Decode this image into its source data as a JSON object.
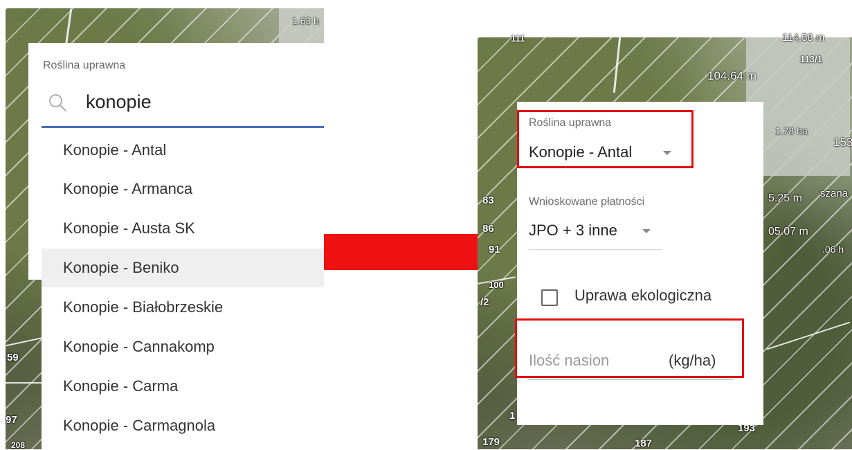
{
  "left_map": {
    "labels": [
      "1.63 h",
      "59",
      "97",
      "208"
    ]
  },
  "crop_dropdown": {
    "label": "Roślina uprawna",
    "search_icon": "search-icon",
    "search_value": "konopie",
    "options": [
      "Konopie - Antal",
      "Konopie - Armanca",
      "Konopie - Austa SK",
      "Konopie - Beniko",
      "Konopie - Białobrzeskie",
      "Konopie - Cannakomp",
      "Konopie - Carma",
      "Konopie - Carmagnola"
    ],
    "highlighted_option": "Konopie - Beniko"
  },
  "arrow": {
    "color": "#ee1111",
    "icon": "right-arrow-icon"
  },
  "right_map": {
    "labels": [
      "111",
      "114.58 m",
      "113/1",
      "104.64 m",
      "1.78 ha",
      "153",
      "83",
      "86",
      "91",
      "100",
      "/2",
      "1",
      "179",
      "187",
      "193",
      "5.25 m",
      "szana",
      "05.07 m",
      ".06 h"
    ]
  },
  "form": {
    "crop_label": "Roślina uprawna",
    "crop_value": "Konopie - Antal",
    "payments_label": "Wnioskowane płatności",
    "payments_value": "JPO + 3 inne",
    "organic_label": "Uprawa ekologiczna",
    "organic_checked": false,
    "seed_placeholder": "Ilość nasion",
    "seed_unit": "(kg/ha)",
    "highlight_color": "#e01010"
  }
}
